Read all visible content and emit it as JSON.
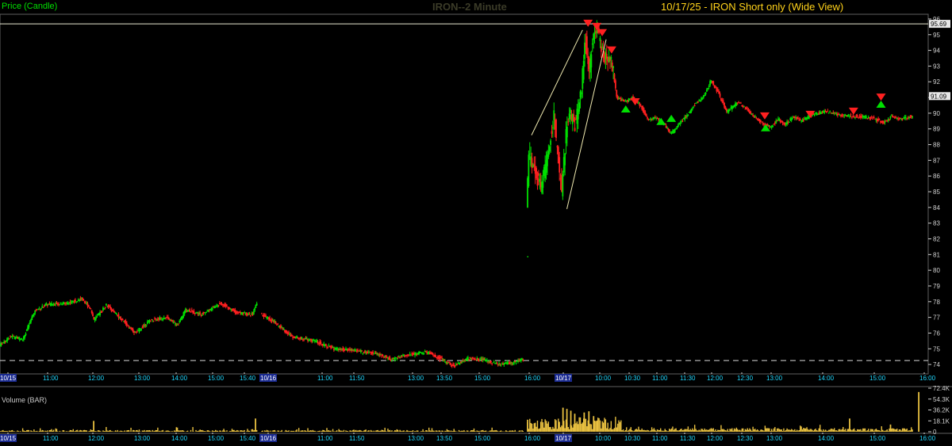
{
  "header": {
    "price_label": "Price (Candle)",
    "title": "IRON--2 Minute",
    "subtitle": "10/17/25 - IRON Short only (Wide View)"
  },
  "volume_panel": {
    "label": "Volume (BAR)"
  },
  "colors": {
    "up": "#00e000",
    "down": "#ff2020",
    "volume": "#e8c040",
    "axis_text": "#d0d0d0",
    "time_text": "#20d8ff",
    "date_box": "#1a2a90",
    "frame": "#606060"
  },
  "chart_data": {
    "type": "candlestick",
    "price_axis": {
      "range": [
        73.4,
        96.3
      ],
      "ticks": [
        74,
        75,
        76,
        77,
        78,
        79,
        80,
        81,
        82,
        83,
        84,
        85,
        86,
        87,
        88,
        89,
        90,
        91,
        92,
        93,
        94,
        95,
        96
      ]
    },
    "price_markers": [
      {
        "label": "95.69",
        "value": 95.69,
        "style": "solid-line"
      },
      {
        "label": "91.09",
        "value": 91.09,
        "style": "tag"
      }
    ],
    "reference_level": 74.25,
    "volume_axis": {
      "range": [
        0,
        72.4
      ],
      "ticks": [
        "72.4K",
        "54.3K",
        "36.2K",
        "18.1K",
        "0"
      ]
    },
    "time_axis": [
      "10/15",
      "11:00",
      "12:00",
      "13:00",
      "14:00",
      "15:00",
      "15:40",
      "10/16",
      "11:00",
      "11:50",
      "13:00",
      "13:50",
      "15:00",
      "16:00",
      "10/17",
      "10:00",
      "10:30",
      "11:00",
      "11:30",
      "12:00",
      "12:30",
      "13:00",
      "14:00",
      "15:00",
      "16:00"
    ],
    "date_labels": [
      "10/15",
      "10/16",
      "10/17"
    ],
    "sessions": [
      {
        "date": "10/15",
        "path": [
          [
            0,
            75.2
          ],
          [
            15,
            75.8
          ],
          [
            30,
            75.6
          ],
          [
            45,
            77.4
          ],
          [
            60,
            77.8
          ],
          [
            85,
            77.9
          ],
          [
            105,
            78.2
          ],
          [
            115,
            77.6
          ],
          [
            120,
            76.8
          ],
          [
            135,
            77.8
          ],
          [
            150,
            77.1
          ],
          [
            172,
            76.0
          ],
          [
            190,
            76.8
          ],
          [
            210,
            77.0
          ],
          [
            225,
            76.5
          ],
          [
            235,
            77.5
          ],
          [
            255,
            77.2
          ],
          [
            280,
            77.9
          ],
          [
            300,
            77.3
          ],
          [
            320,
            77.2
          ],
          [
            325,
            77.9
          ]
        ]
      },
      {
        "date": "10/16",
        "path": [
          [
            0,
            77.2
          ],
          [
            15,
            76.8
          ],
          [
            40,
            75.8
          ],
          [
            70,
            75.5
          ],
          [
            95,
            75.0
          ],
          [
            120,
            74.9
          ],
          [
            150,
            74.7
          ],
          [
            170,
            74.3
          ],
          [
            190,
            74.6
          ],
          [
            215,
            74.8
          ],
          [
            240,
            74.2
          ],
          [
            250,
            73.9
          ],
          [
            270,
            74.4
          ],
          [
            290,
            74.3
          ],
          [
            310,
            74.0
          ],
          [
            325,
            74.1
          ],
          [
            340,
            74.3
          ]
        ]
      },
      {
        "date": "10/17",
        "path": [
          [
            0,
            84.0
          ],
          [
            3,
            87.2
          ],
          [
            12,
            86.0
          ],
          [
            18,
            85.3
          ],
          [
            28,
            87.5
          ],
          [
            35,
            90.0
          ],
          [
            40,
            87.0
          ],
          [
            45,
            85.0
          ],
          [
            50,
            88.5
          ],
          [
            55,
            90.0
          ],
          [
            62,
            89.2
          ],
          [
            70,
            91.5
          ],
          [
            75,
            94.8
          ],
          [
            80,
            92.4
          ],
          [
            85,
            95.5
          ],
          [
            90,
            95.3
          ],
          [
            95,
            94.2
          ],
          [
            100,
            93.5
          ],
          [
            107,
            93.8
          ],
          [
            115,
            91.0
          ],
          [
            125,
            90.7
          ],
          [
            135,
            91.0
          ],
          [
            145,
            90.5
          ],
          [
            155,
            89.6
          ],
          [
            165,
            89.7
          ],
          [
            175,
            89.3
          ],
          [
            185,
            88.7
          ],
          [
            195,
            89.4
          ],
          [
            205,
            89.9
          ],
          [
            215,
            90.6
          ],
          [
            225,
            91.0
          ],
          [
            235,
            92.1
          ],
          [
            245,
            91.2
          ],
          [
            255,
            90.1
          ],
          [
            270,
            90.7
          ],
          [
            285,
            90.0
          ],
          [
            300,
            89.4
          ],
          [
            310,
            89.1
          ],
          [
            320,
            89.6
          ],
          [
            330,
            89.3
          ],
          [
            340,
            89.8
          ],
          [
            350,
            89.5
          ],
          [
            365,
            89.9
          ],
          [
            380,
            90.1
          ],
          [
            400,
            89.9
          ],
          [
            420,
            89.8
          ],
          [
            440,
            89.7
          ],
          [
            455,
            89.4
          ],
          [
            465,
            89.8
          ],
          [
            475,
            89.6
          ],
          [
            490,
            89.8
          ]
        ]
      }
    ],
    "wedge_lines": [
      {
        "from": [
          0,
          88.6
        ],
        "to": [
          65,
          95.3
        ]
      },
      {
        "from": [
          45,
          83.9
        ],
        "to": [
          95,
          94.7
        ]
      }
    ],
    "signals": [
      {
        "type": "sell",
        "session": "10/17",
        "t": 77,
        "value": 95.7
      },
      {
        "type": "sell",
        "session": "10/17",
        "t": 88,
        "value": 95.5
      },
      {
        "type": "sell",
        "session": "10/17",
        "t": 95,
        "value": 95.1
      },
      {
        "type": "sell",
        "session": "10/17",
        "t": 107,
        "value": 94.0
      },
      {
        "type": "buy",
        "session": "10/17",
        "t": 125,
        "value": 90.3
      },
      {
        "type": "sell",
        "session": "10/17",
        "t": 137,
        "value": 90.7
      },
      {
        "type": "buy",
        "session": "10/17",
        "t": 170,
        "value": 89.5
      },
      {
        "type": "buy",
        "session": "10/17",
        "t": 183,
        "value": 89.7
      },
      {
        "type": "sell",
        "session": "10/17",
        "t": 302,
        "value": 89.8
      },
      {
        "type": "buy",
        "session": "10/17",
        "t": 303,
        "value": 89.1
      },
      {
        "type": "sell",
        "session": "10/17",
        "t": 360,
        "value": 89.9
      },
      {
        "type": "sell",
        "session": "10/17",
        "t": 415,
        "value": 90.1
      },
      {
        "type": "sell",
        "session": "10/17",
        "t": 450,
        "value": 91.0
      },
      {
        "type": "buy",
        "session": "10/17",
        "t": 450,
        "value": 90.6
      }
    ],
    "volume_spikes_k": [
      {
        "session": "10/15",
        "t": 118,
        "value": 18
      },
      {
        "session": "10/15",
        "t": 322,
        "value": 22
      },
      {
        "session": "10/17",
        "t": 0,
        "value": 20
      },
      {
        "session": "10/17",
        "t": 45,
        "value": 40
      },
      {
        "session": "10/17",
        "t": 50,
        "value": 38
      },
      {
        "session": "10/17",
        "t": 55,
        "value": 35
      },
      {
        "session": "10/17",
        "t": 60,
        "value": 30
      },
      {
        "session": "10/17",
        "t": 72,
        "value": 32
      },
      {
        "session": "10/17",
        "t": 78,
        "value": 34
      },
      {
        "session": "10/17",
        "t": 84,
        "value": 26
      },
      {
        "session": "10/17",
        "t": 410,
        "value": 22
      },
      {
        "session": "10/17",
        "t": 462,
        "value": 12
      },
      {
        "session": "10/17",
        "t": 498,
        "value": 66
      }
    ]
  }
}
